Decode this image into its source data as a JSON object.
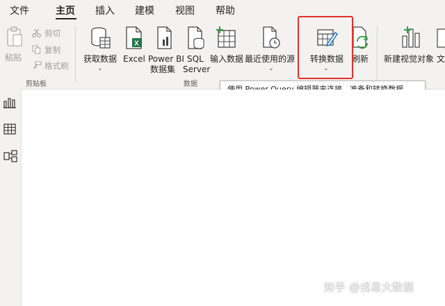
{
  "menu": {
    "items": [
      "文件",
      "主页",
      "插入",
      "建模",
      "视图",
      "帮助"
    ],
    "active": "主页"
  },
  "clipboard": {
    "paste": "粘贴",
    "cut": "剪切",
    "copy": "复制",
    "format_painter": "格式刷",
    "group_label": "剪贴板"
  },
  "data_group": {
    "get_data": "获取数据",
    "excel": "Excel",
    "powerbi_line1": "Power BI",
    "powerbi_line2": "数据集",
    "sql_line1": "SQL",
    "sql_line2": "Server",
    "enter_data": "输入数据",
    "recent_sources": "最近使用的源",
    "transform_data": "转换数据",
    "refresh": "刷新",
    "group_label": "数据"
  },
  "insert_group": {
    "new_visual": "新建视觉对象",
    "text_box": "文"
  },
  "tooltip": "使用 Power Query 编辑器来连接、准备和转换数据。",
  "watermark": "知乎 @戎易大数据",
  "colors": {
    "highlight": "#e0302a",
    "arrow": "#e0302a",
    "ribbon_bg": "#f3f2f1",
    "excel_green": "#217346"
  }
}
